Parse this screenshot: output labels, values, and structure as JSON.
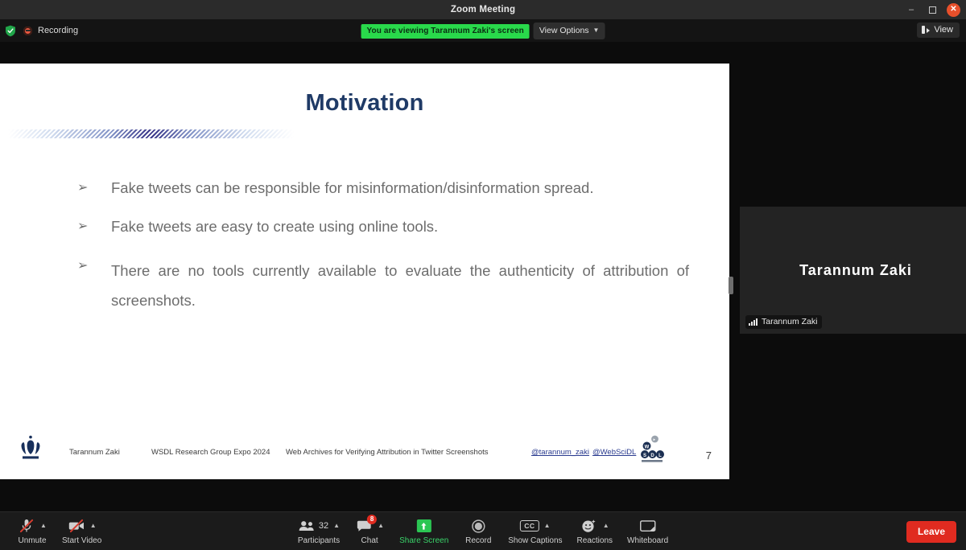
{
  "window": {
    "title": "Zoom Meeting",
    "minimize_label": "–",
    "maximize_label": "❐",
    "close_label": "✕"
  },
  "topbar": {
    "shield_icon": "security-shield-icon",
    "recording_label": "Recording",
    "share_banner": "You are viewing Tarannum Zaki's screen",
    "view_options_label": "View Options",
    "view_options_caret": "⌄",
    "view_button_label": "View"
  },
  "slide": {
    "title": "Motivation",
    "bullet_marker": "➢",
    "bullets": [
      "Fake tweets can be responsible for misinformation/disinformation spread.",
      "Fake tweets are easy to create using online tools.",
      "There are no tools currently available to evaluate the authenticity of attribution of screenshots."
    ],
    "footer": {
      "presenter": "Tarannum Zaki",
      "event": "WSDL Research Group Expo 2024",
      "paper_title": "Web Archives for Verifying Attribution in Twitter Screenshots",
      "handle_personal": "@tarannum_zaki",
      "handle_group": "@WebSciDL",
      "page_number": "7",
      "logo_left": "odu-crown-logo",
      "logo_right": "wsdl-logo",
      "wsdl_letters": [
        "W",
        "S",
        "D",
        "L"
      ]
    },
    "accent_color": "#1f3a66",
    "body_text_color": "#6d6d6d"
  },
  "right_panel": {
    "tile_display_name": "Tarannum Zaki",
    "tile_label_name": "Tarannum Zaki",
    "signal_icon": "signal-bars-icon"
  },
  "toolbar": {
    "audio": {
      "label": "Unmute",
      "icon": "microphone-muted-icon",
      "caret": "⌃"
    },
    "video": {
      "label": "Start Video",
      "icon": "camera-off-icon",
      "caret": "⌃"
    },
    "participants": {
      "label": "Participants",
      "icon": "participants-icon",
      "count": "32",
      "caret": "⌃"
    },
    "chat": {
      "label": "Chat",
      "icon": "chat-bubble-icon",
      "badge": "8",
      "caret": "⌃"
    },
    "share_screen": {
      "label": "Share Screen",
      "icon": "share-screen-icon"
    },
    "record": {
      "label": "Record",
      "icon": "record-circle-icon"
    },
    "captions": {
      "label": "Show Captions",
      "icon": "closed-caption-icon",
      "caret": "⌃"
    },
    "reactions": {
      "label": "Reactions",
      "icon": "reactions-smiley-icon",
      "caret": "⌃"
    },
    "whiteboard": {
      "label": "Whiteboard",
      "icon": "whiteboard-icon"
    },
    "leave": {
      "label": "Leave"
    },
    "share_green": "#2bc653",
    "leave_red": "#e02b20"
  }
}
